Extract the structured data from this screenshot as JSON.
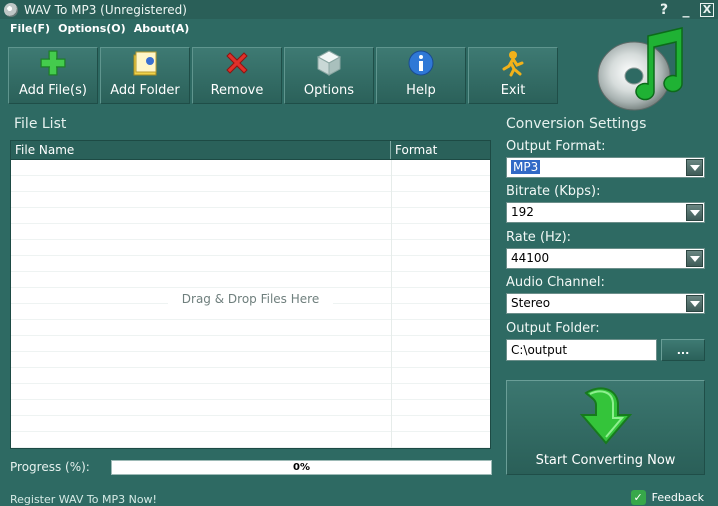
{
  "window": {
    "title": "WAV To MP3  (Unregistered)",
    "help_glyph": "?",
    "minimize_glyph": "_",
    "close_glyph": "X"
  },
  "menu": {
    "items": [
      {
        "label": "File(F)"
      },
      {
        "label": "Options(O)"
      },
      {
        "label": "About(A)"
      }
    ]
  },
  "toolbar": {
    "buttons": [
      {
        "label": "Add File(s)",
        "icon": "plus-icon"
      },
      {
        "label": "Add Folder",
        "icon": "folder-icon"
      },
      {
        "label": "Remove",
        "icon": "red-x-icon"
      },
      {
        "label": "Options",
        "icon": "cube-icon"
      },
      {
        "label": "Help",
        "icon": "info-icon"
      },
      {
        "label": "Exit",
        "icon": "running-man-icon"
      }
    ]
  },
  "file_list": {
    "section_title": "File List",
    "columns": [
      "File Name",
      "Format"
    ],
    "drop_hint": "Drag & Drop Files Here",
    "rows": []
  },
  "progress": {
    "label": "Progress (%):",
    "value": 0,
    "text": "0%"
  },
  "settings": {
    "section_title": "Conversion Settings",
    "output_format": {
      "label": "Output Format:",
      "value": "MP3"
    },
    "bitrate": {
      "label": "Bitrate (Kbps):",
      "value": "192"
    },
    "rate": {
      "label": "Rate (Hz):",
      "value": "44100"
    },
    "channel": {
      "label": "Audio Channel:",
      "value": "Stereo"
    },
    "output_folder": {
      "label": "Output Folder:",
      "value": "C:\\output",
      "browse_label": "..."
    },
    "convert_button": "Start Converting Now"
  },
  "status": {
    "register_link": "Register WAV To MP3 Now!",
    "feedback": "Feedback"
  },
  "colors": {
    "background": "#2e6a63",
    "accent_green": "#2fb33a",
    "selection": "#3169c6"
  }
}
